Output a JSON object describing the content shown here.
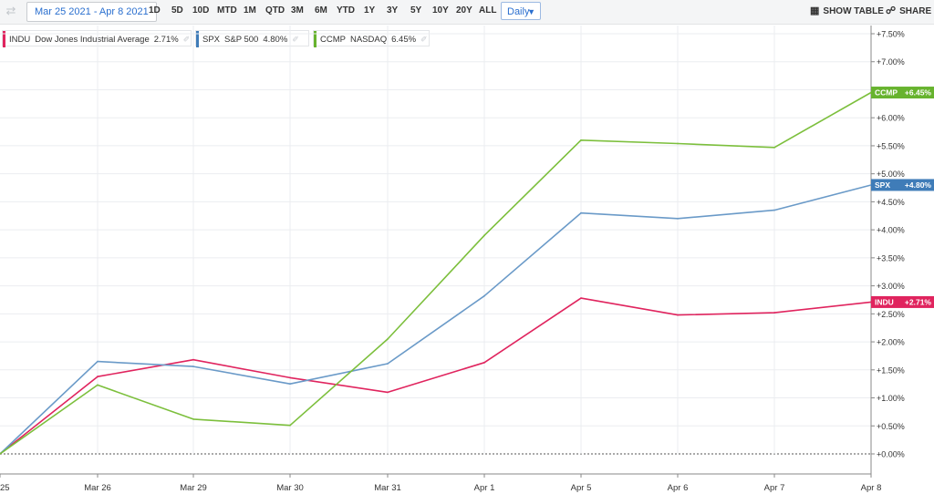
{
  "toolbar": {
    "date_range": "Mar 25 2021 - Apr 8 2021",
    "ranges": [
      "1D",
      "5D",
      "10D",
      "MTD",
      "1M",
      "QTD",
      "3M",
      "6M",
      "YTD",
      "1Y",
      "3Y",
      "5Y",
      "10Y",
      "20Y",
      "ALL"
    ],
    "interval": "Daily",
    "show_table": "SHOW TABLE",
    "share": "SHARE"
  },
  "legend": [
    {
      "symbol": "INDU",
      "name": "Dow Jones Industrial Average",
      "value": "2.71%",
      "color": "#e0245e"
    },
    {
      "symbol": "SPX",
      "name": "S&P 500",
      "value": "4.80%",
      "color": "#3f7cb8"
    },
    {
      "symbol": "CCMP",
      "name": "NASDAQ",
      "value": "6.45%",
      "color": "#67b32e"
    }
  ],
  "chart_data": {
    "type": "line",
    "x": [
      "25",
      "Mar 26",
      "Mar 29",
      "Mar 30",
      "Mar 31",
      "Apr 1",
      "Apr 5",
      "Apr 6",
      "Apr 7",
      "Apr 8"
    ],
    "y_ticks": [
      "+0.00%",
      "+0.50%",
      "+1.00%",
      "+1.50%",
      "+2.00%",
      "+2.50%",
      "+3.00%",
      "+3.50%",
      "+4.00%",
      "+4.50%",
      "+5.00%",
      "+5.50%",
      "+6.00%",
      "+6.50%",
      "+7.00%",
      "+7.50%"
    ],
    "ylim": [
      0,
      7.5
    ],
    "y_axis_side": "right",
    "series": [
      {
        "name": "INDU",
        "color": "#e0245e",
        "end_label": "+2.71%",
        "values": [
          0,
          1.38,
          1.68,
          1.36,
          1.1,
          1.63,
          2.78,
          2.48,
          2.52,
          2.71
        ]
      },
      {
        "name": "SPX",
        "color": "#6a9ac8",
        "tag_color": "#3f7cb8",
        "end_label": "+4.80%",
        "values": [
          0,
          1.65,
          1.56,
          1.25,
          1.61,
          2.82,
          4.3,
          4.2,
          4.35,
          4.8
        ]
      },
      {
        "name": "CCMP",
        "color": "#7cbf3c",
        "tag_color": "#67b32e",
        "end_label": "+6.45%",
        "values": [
          0,
          1.23,
          0.62,
          0.51,
          2.05,
          3.9,
          5.6,
          5.54,
          5.47,
          6.45
        ]
      }
    ]
  }
}
